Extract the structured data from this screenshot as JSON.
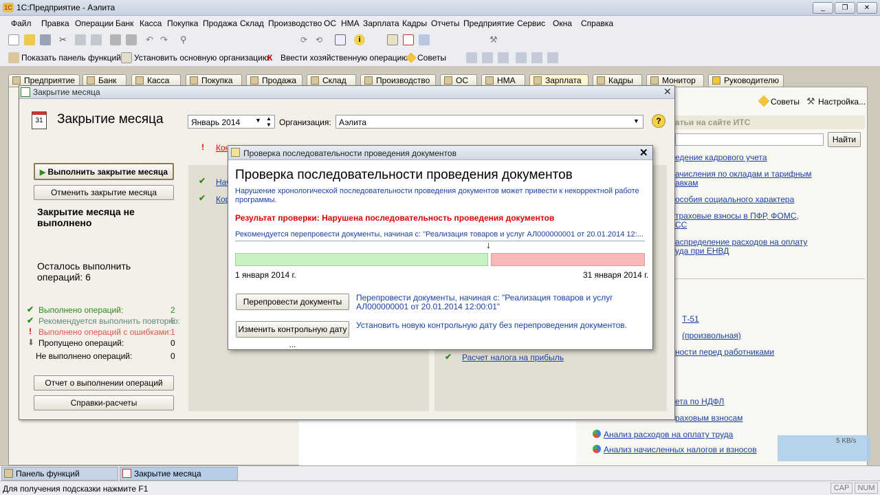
{
  "window": {
    "title": "1С:Предприятие - Аэлита"
  },
  "menu": [
    "Файл",
    "Правка",
    "Операции",
    "Банк",
    "Касса",
    "Покупка",
    "Продажа",
    "Склад",
    "Производство",
    "ОС",
    "НМА",
    "Зарплата",
    "Кадры",
    "Отчеты",
    "Предприятие",
    "Сервис",
    "Окна",
    "Справка"
  ],
  "toolbar2": {
    "show_panel": "Показать панель функций",
    "set_org": "Установить основную организацию",
    "enter_op": "Ввести хозяйственную операцию",
    "tips": "Советы"
  },
  "section_tabs": [
    "Предприятие",
    "Банк",
    "Касса",
    "Покупка",
    "Продажа",
    "Склад",
    "Производство",
    "ОС",
    "НМА",
    "Зарплата",
    "Кадры",
    "Монитор",
    "Руководителю"
  ],
  "desktop": {
    "tips_link": "Советы",
    "settings_link": "Настройка...",
    "its_heading": "атьи на сайте ИТС",
    "find_button": "Найти",
    "links_right": [
      "едение кадрового учета",
      "ачисления по окладам и тарифным",
      "авкам",
      "особия социального характера",
      "траховые взносы в ПФР, ФОМС,",
      "СС",
      "аспределение расходов на оплату",
      "уда при ЕНВД"
    ],
    "links_lower": [
      "Т-51",
      "(произвольная)",
      "ности перед работниками",
      "ета по НДФЛ",
      "раховым взносам"
    ],
    "report1": "Анализ расходов на оплату труда",
    "report2": "Анализ начисленных налогов и взносов",
    "tax_link": "Расчет налога на прибыль",
    "net_rate": "5 KB/s"
  },
  "month_close": {
    "window_title": "Закрытие месяца",
    "heading": "Закрытие месяца",
    "period": "Январь 2014",
    "org_label": "Организация:",
    "org_value": "Аэлита",
    "run_button": "Выполнить закрытие месяца",
    "cancel_button": "Отменить закрытие месяца",
    "status_text": "Закрытие месяца не выполнено",
    "remaining_text": "Осталось выполнить операций: 6",
    "stats": [
      {
        "label": "Выполнено операций:",
        "value": "2"
      },
      {
        "label": "Рекомендуется выполнить повторно:",
        "value": "5"
      },
      {
        "label": "Выполнено операций с ошибками:",
        "value": "1"
      },
      {
        "label": "Пропущено операций:",
        "value": "0"
      },
      {
        "label": "Не выполнено операций:",
        "value": "0"
      }
    ],
    "report_button": "Отчет о выполнении операций",
    "calc_button": "Справки-расчеты",
    "frag_kon": "Кон",
    "frag_nach": "Нач",
    "frag_kor": "Кор"
  },
  "dialog": {
    "window_title": "Проверка последовательности проведения документов",
    "heading": "Проверка последовательности проведения документов",
    "description": "Нарушение хронологической последовательности проведения документов может привести к некорректной работе программы.",
    "result": "Результат проверки: Нарушена последовательность проведения документов",
    "recommend": "Рекомендуется перепровести документы, начиная с: \"Реализация товаров и услуг АЛ000000001 от 20.01.2014 12:...",
    "timeline_start": "1 января 2014 г.",
    "timeline_end": "31 января 2014 г.",
    "timeline_ok_fraction": 0.62,
    "repost_button": "Перепровести документы",
    "repost_text": "Перепровести документы, начиная с: \"Реализация товаров и услуг АЛ000000001 от 20.01.2014 12:00:01\"",
    "change_date_button": "Изменить контрольную дату ...",
    "change_date_text": "Установить новую контрольную дату без перепроведения документов."
  },
  "taskbar": {
    "panel": "Панель функций",
    "month": "Закрытие месяца"
  },
  "statusbar": {
    "hint": "Для получения подсказки нажмите F1",
    "cap": "CAP",
    "num": "NUM"
  },
  "colors": {
    "link": "#1a3fa8",
    "error": "#e00000",
    "ok_bar": "#c8f2c4",
    "bad_bar": "#f6b8b8"
  }
}
